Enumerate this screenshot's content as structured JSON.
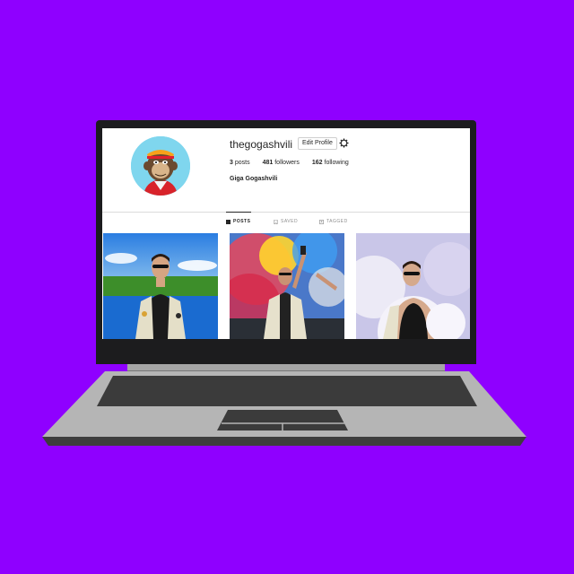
{
  "profile": {
    "username": "thegogashvili",
    "edit_profile_label": "Edit Profile",
    "full_name": "Giga Gogashvili",
    "stats": {
      "posts_count": "3",
      "posts_label": "posts",
      "followers_count": "481",
      "followers_label": "followers",
      "following_count": "162",
      "following_label": "following"
    }
  },
  "tabs": [
    {
      "label": "POSTS",
      "active": true,
      "icon": "grid-icon"
    },
    {
      "label": "SAVED",
      "active": false,
      "icon": "bookmark-icon"
    },
    {
      "label": "TAGGED",
      "active": false,
      "icon": "tag-icon"
    }
  ],
  "posts": [
    {
      "description_icon": "photo-man-sunglasses-lake"
    },
    {
      "description_icon": "photo-man-smoke-flares"
    },
    {
      "description_icon": "photo-man-white-smoke"
    }
  ],
  "colors": {
    "background": "#8f00ff",
    "bezel": "#1c1c1e",
    "laptop_body": "#b3b3b3",
    "keyboard": "#3a3a3a",
    "screen": "#ffffff"
  }
}
